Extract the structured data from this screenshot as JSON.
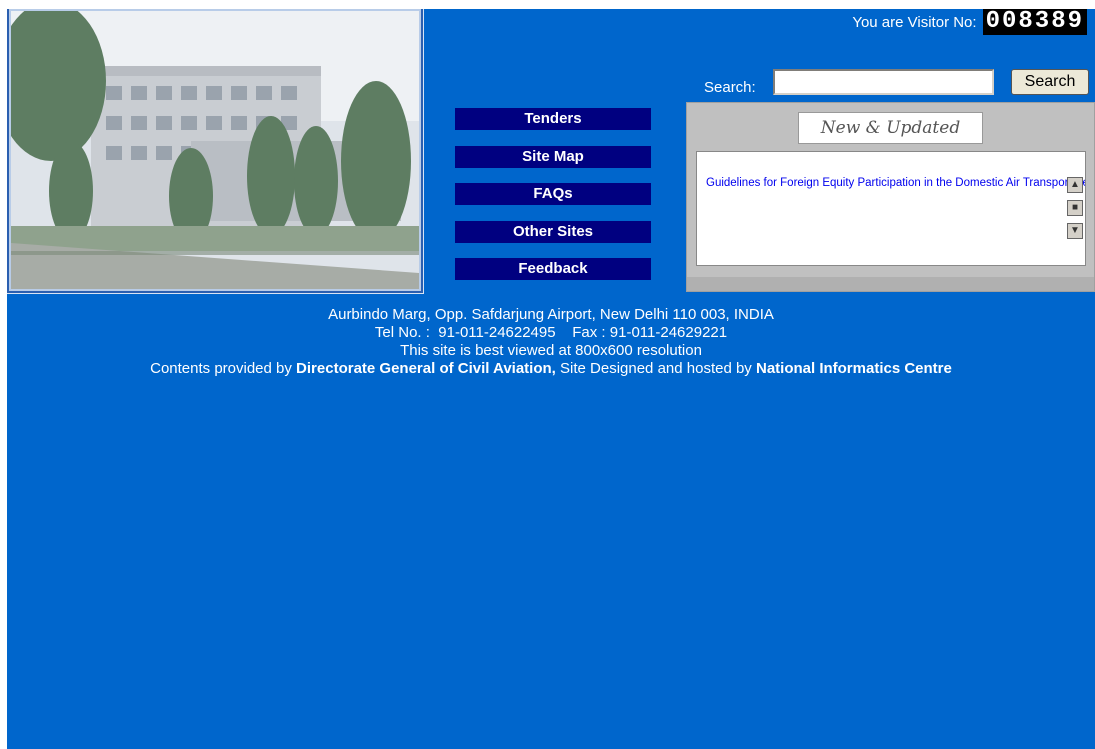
{
  "visitor": {
    "label": "You are Visitor No:",
    "count": "008389"
  },
  "search": {
    "label": "Search:",
    "value": "",
    "button_label": "Search"
  },
  "nav": {
    "items": [
      {
        "label": "Tenders"
      },
      {
        "label": "Site Map"
      },
      {
        "label": "FAQs"
      },
      {
        "label": "Other Sites"
      },
      {
        "label": "Feedback"
      }
    ]
  },
  "news": {
    "header": "New & Updated",
    "items": [
      {
        "text": "Guidelines for Foreign Equity Participation in the Domestic Air Transport Sector"
      }
    ]
  },
  "footer": {
    "address": "Aurbindo Marg, Opp. Safdarjung Airport, New Delhi 110 003, INDIA",
    "contact": "Tel No. :  91-011-24622495    Fax : 91-011-24629221",
    "resolution_note": "This site is best viewed at 800x600 resolution",
    "contents_prefix": "Contents provided by ",
    "content_provider": "Directorate General of Civil Aviation,",
    "hosted_prefix": " Site Designed and hosted by ",
    "host": "National Informatics Centre"
  },
  "colors": {
    "page_background": "#0066cc",
    "nav_background": "#000080",
    "news_link": "#0000ee"
  }
}
